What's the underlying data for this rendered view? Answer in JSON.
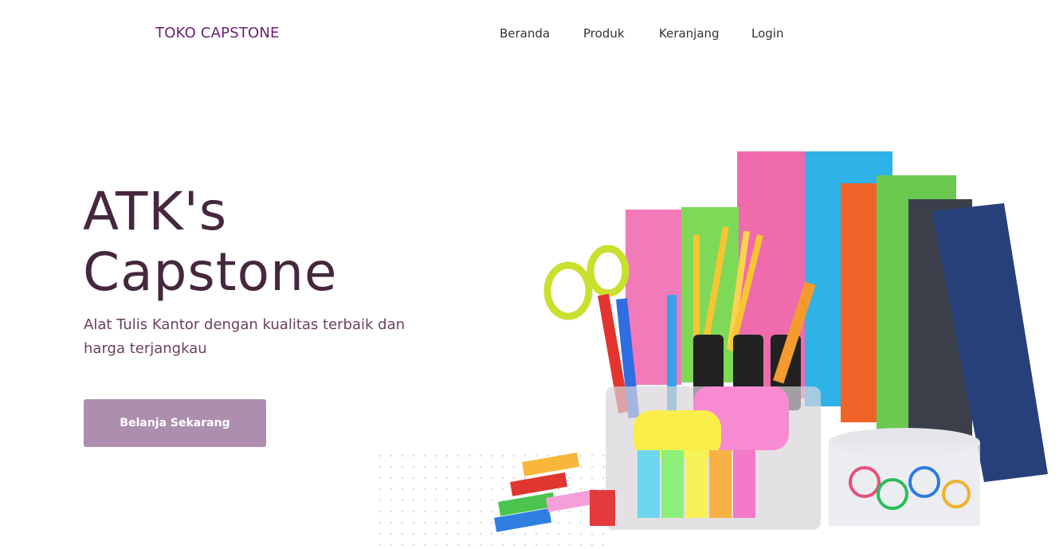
{
  "header": {
    "brand": "TOKO CAPSTONE",
    "nav": [
      "Beranda",
      "Produk",
      "Keranjang",
      "Login"
    ]
  },
  "hero": {
    "title_line1": "ATK's",
    "title_line2": "Capstone",
    "subtitle": "Alat Tulis Kantor dengan kualitas terbaik dan harga terjangkau",
    "cta": "Belanja Sekarang"
  },
  "colors": {
    "brand": "#6a1f72",
    "title": "#45283d",
    "cta_bg": "#ad8eaf"
  }
}
